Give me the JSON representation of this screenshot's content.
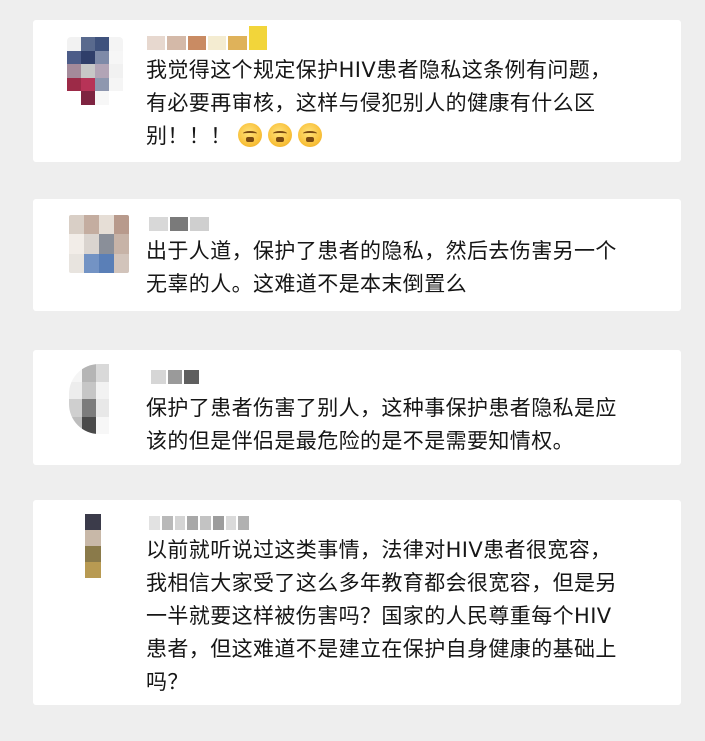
{
  "comments": [
    {
      "username": "",
      "lines": [
        "我觉得这个规定保护HIV患者隐私这条例有问题，",
        "有必要再审核，这样与侵犯别人的健康有什么区",
        "别！！！"
      ],
      "emoji": [
        "angry-face",
        "angry-face",
        "angry-face"
      ],
      "avatar_colors": [
        "#f2f2f2",
        "#596a8e",
        "#3f527d",
        "#f4f4f4",
        "#4c5c88",
        "#2f3e6a",
        "#7e8aa8",
        "#f6f6f6",
        "#a48a9a",
        "#c7c7c7",
        "#b2a4b6",
        "#f1f1f1",
        "#9c2a47",
        "#b73357",
        "#8e97af",
        "#f5f5f5",
        "#ffffff",
        "#7e2441",
        "#f7f7f7",
        "#ffffff"
      ],
      "username_colors": [
        "#e7d8cf",
        "#d4b9a8",
        "#c98b63",
        "#f4ecd1",
        "#dfb25a",
        "#f2d53a"
      ]
    },
    {
      "username": "",
      "lines": [
        "出于人道，保护了患者的隐私，然后去伤害另一个",
        "无辜的人。这难道不是本末倒置么"
      ],
      "emoji": [],
      "avatar_colors": [
        "#d9cfc6",
        "#c4ada0",
        "#e6ded6",
        "#b89a8c",
        "#f2ede8",
        "#dad4cf",
        "#8a8f99",
        "#c7b3a7",
        "#e8e4df",
        "#7393c4",
        "#5a7fb7",
        "#d2c4bb"
      ],
      "username_colors": [
        "#d8d8d8",
        "#7a7a7a",
        "#cfcfcf"
      ]
    },
    {
      "username": "",
      "lines": [
        "保护了患者伤害了别人，这种事保护患者隐私是应",
        "该的但是伴侣是最危险的是不是需要知情权。"
      ],
      "emoji": [],
      "avatar_colors": [
        "#f5f5f5",
        "#b5b5b5",
        "#d9d9d9",
        "#ededed",
        "#c6c6c6",
        "#f2f2f2",
        "#cfcfcf",
        "#7c7c7c",
        "#e8e8e8",
        "#bdbdbd",
        "#4a4a4a",
        "#f7f7f7"
      ],
      "username_colors": [
        "#d6d6d6",
        "#9a9a9a",
        "#5f5f5f"
      ]
    },
    {
      "username": "",
      "lines": [
        "以前就听说过这类事情，法律对HIV患者很宽容，",
        "我相信大家受了这么多年教育都会很宽容，但是另",
        "一半就要这样被伤害吗？国家的人民尊重每个HIV",
        "患者，但这难道不是建立在保护自身健康的基础上",
        "吗？"
      ],
      "emoji": [],
      "avatar_colors": [
        "#3b3b4a",
        "#c8b8a8",
        "#8a7a4a",
        "#b89a52"
      ],
      "username_colors": [
        "#e2e2e2",
        "#b9b9b9",
        "#d4d4d4",
        "#a8a8a8",
        "#c3c3c3",
        "#9d9d9d",
        "#dadada",
        "#b1b1b1"
      ]
    }
  ]
}
